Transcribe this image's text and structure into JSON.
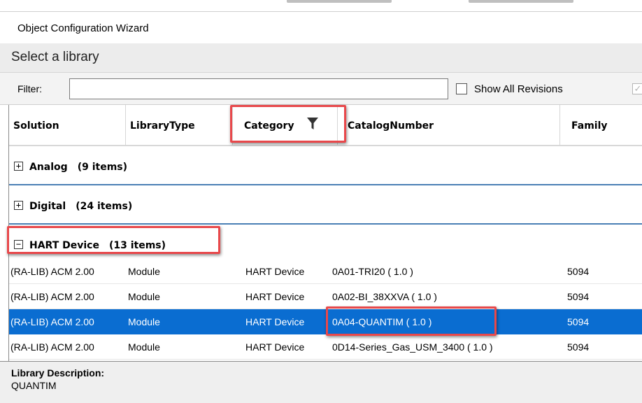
{
  "window": {
    "title": "Object Configuration Wizard"
  },
  "section": {
    "heading": "Select a library"
  },
  "filter": {
    "label": "Filter:",
    "value": "",
    "show_all_revisions_label": "Show All Revisions",
    "show_all_revisions_checked": false
  },
  "grid": {
    "columns": [
      "Solution",
      "LibraryType",
      "Category",
      "CatalogNumber",
      "Family"
    ],
    "filter_applied_column": "Category",
    "groups": [
      {
        "name": "Analog",
        "count": "(9 items)",
        "expanded": false,
        "expander": "+"
      },
      {
        "name": "Digital",
        "count": "(24 items)",
        "expanded": false,
        "expander": "+"
      },
      {
        "name": "HART Device",
        "count": "(13 items)",
        "expanded": true,
        "expander": "−"
      }
    ],
    "rows": [
      {
        "solution": "(RA-LIB) ACM 2.00",
        "library_type": "Module",
        "category": "HART Device",
        "catalog_number": "0A01-TRI20  ( 1.0 )",
        "family": "5094",
        "selected": false
      },
      {
        "solution": "(RA-LIB) ACM 2.00",
        "library_type": "Module",
        "category": "HART Device",
        "catalog_number": "0A02-BI_38XXVA  ( 1.0 )",
        "family": "5094",
        "selected": false
      },
      {
        "solution": "(RA-LIB) ACM 2.00",
        "library_type": "Module",
        "category": "HART Device",
        "catalog_number": "0A04-QUANTIM  ( 1.0 )",
        "family": "5094",
        "selected": true
      },
      {
        "solution": "(RA-LIB) ACM 2.00",
        "library_type": "Module",
        "category": "HART Device",
        "catalog_number": "0D14-Series_Gas_USM_3400  ( 1.0 )",
        "family": "5094",
        "selected": false
      }
    ]
  },
  "description": {
    "label": "Library Description:",
    "value": "QUANTIM"
  },
  "colors": {
    "selection": "#0a6dd1",
    "group_separator": "#4a7fb5",
    "annotation": "#e8484b"
  }
}
